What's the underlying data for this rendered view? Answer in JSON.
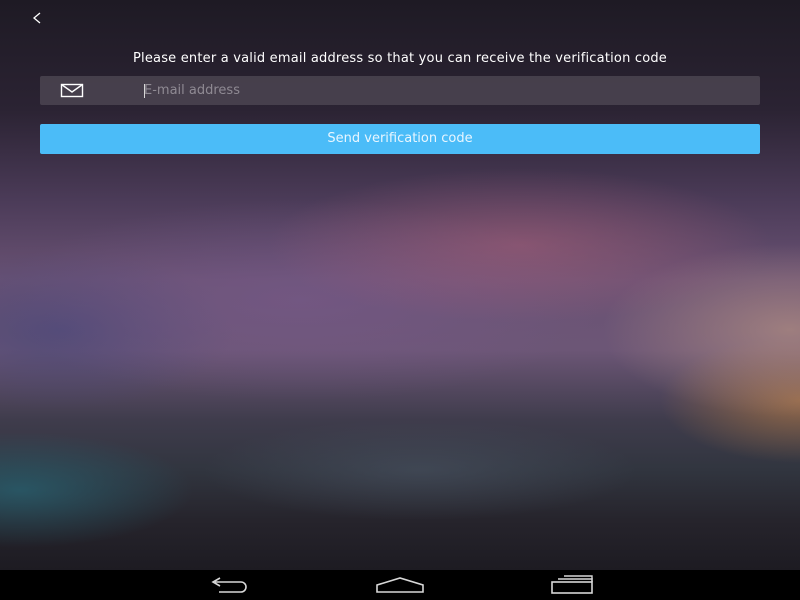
{
  "header": {
    "back_icon": "chevron-left-icon"
  },
  "form": {
    "instruction": "Please enter a valid email address so that you can receive the verification code",
    "email_icon": "mail-icon",
    "email_value": "",
    "email_placeholder": "E-mail address",
    "send_button_label": "Send verification code"
  },
  "system_nav": {
    "back_icon": "nav-back-icon",
    "home_icon": "nav-home-icon",
    "recents_icon": "nav-recents-icon"
  },
  "colors": {
    "accent": "#4bbcf8",
    "input_bg": "#504a56",
    "nav_bar": "#000000",
    "text": "#ffffff"
  }
}
